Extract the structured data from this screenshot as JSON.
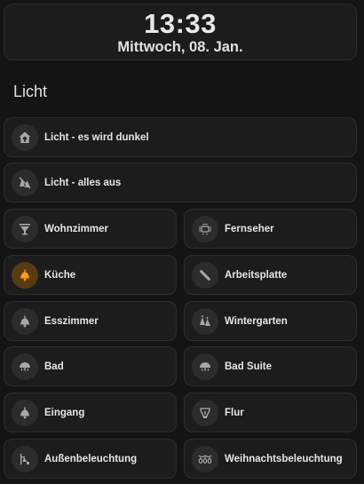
{
  "clock": {
    "time": "13:33",
    "date": "Mittwoch, 08. Jan."
  },
  "section": {
    "title": "Licht"
  },
  "scenes": [
    {
      "label": "Licht - es wird dunkel",
      "icon": "home-lightbulb-icon"
    },
    {
      "label": "Licht - alles aus",
      "icon": "lights-off-icon"
    }
  ],
  "rooms": [
    {
      "label": "Wohnzimmer",
      "icon": "ceiling-lamp-icon",
      "state": "off"
    },
    {
      "label": "Fernseher",
      "icon": "tv-ambilight-icon",
      "state": "off"
    },
    {
      "label": "Küche",
      "icon": "ceiling-light-icon",
      "state": "on"
    },
    {
      "label": "Arbeitsplatte",
      "icon": "led-strip-icon",
      "state": "off"
    },
    {
      "label": "Esszimmer",
      "icon": "ceiling-light-icon",
      "state": "off"
    },
    {
      "label": "Wintergarten",
      "icon": "lights-group-icon",
      "state": "off"
    },
    {
      "label": "Bad",
      "icon": "dome-light-icon",
      "state": "off"
    },
    {
      "label": "Bad Suite",
      "icon": "dome-light-icon",
      "state": "off"
    },
    {
      "label": "Eingang",
      "icon": "ceiling-light-icon",
      "state": "off"
    },
    {
      "label": "Flur",
      "icon": "track-light-icon",
      "state": "off"
    },
    {
      "label": "Außenbeleuchtung",
      "icon": "outdoor-lamp-icon",
      "state": "off"
    },
    {
      "label": "Weihnachtsbeleuchtung",
      "icon": "string-lights-icon",
      "state": "off"
    }
  ],
  "colors": {
    "icon_off": "#a8a8a8",
    "icon_on": "#ff9c1a",
    "icon_bg_on": "#5a3a12"
  }
}
